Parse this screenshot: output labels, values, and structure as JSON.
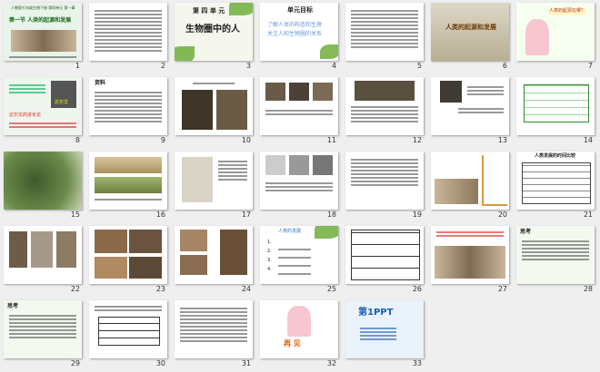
{
  "slides": [
    {
      "n": "1",
      "title": "第一节 人类的起源和发展",
      "top": "人教版七年级生物下册 第四单元 第一章"
    },
    {
      "n": "2"
    },
    {
      "n": "3",
      "unit": "第 四 单 元",
      "title": "生物圈中的人"
    },
    {
      "n": "4",
      "heading": "单元目标",
      "line1": "了解人体的构造和生理",
      "line2": "关注人和生物圈的关系"
    },
    {
      "n": "5"
    },
    {
      "n": "6",
      "title": "人类的起源和发展"
    },
    {
      "n": "7",
      "bubble": "人类的起源在哪？"
    },
    {
      "n": "8",
      "q": "达尔文的进化论",
      "name": "达尔文"
    },
    {
      "n": "9",
      "heading": "资料"
    },
    {
      "n": "10"
    },
    {
      "n": "11"
    },
    {
      "n": "12"
    },
    {
      "n": "13"
    },
    {
      "n": "14"
    },
    {
      "n": "15"
    },
    {
      "n": "16"
    },
    {
      "n": "17"
    },
    {
      "n": "18"
    },
    {
      "n": "19"
    },
    {
      "n": "20"
    },
    {
      "n": "21",
      "title": "人类发展的时间比较"
    },
    {
      "n": "22"
    },
    {
      "n": "23"
    },
    {
      "n": "24"
    },
    {
      "n": "25",
      "title": "人类的发展",
      "items": [
        "1.",
        "2.",
        "3.",
        "4."
      ]
    },
    {
      "n": "26"
    },
    {
      "n": "27"
    },
    {
      "n": "28",
      "heading": "思考"
    },
    {
      "n": "29",
      "heading": "思考"
    },
    {
      "n": "30"
    },
    {
      "n": "31"
    },
    {
      "n": "32",
      "text": "再 见"
    },
    {
      "n": "33",
      "logo": "第1PPT"
    }
  ]
}
